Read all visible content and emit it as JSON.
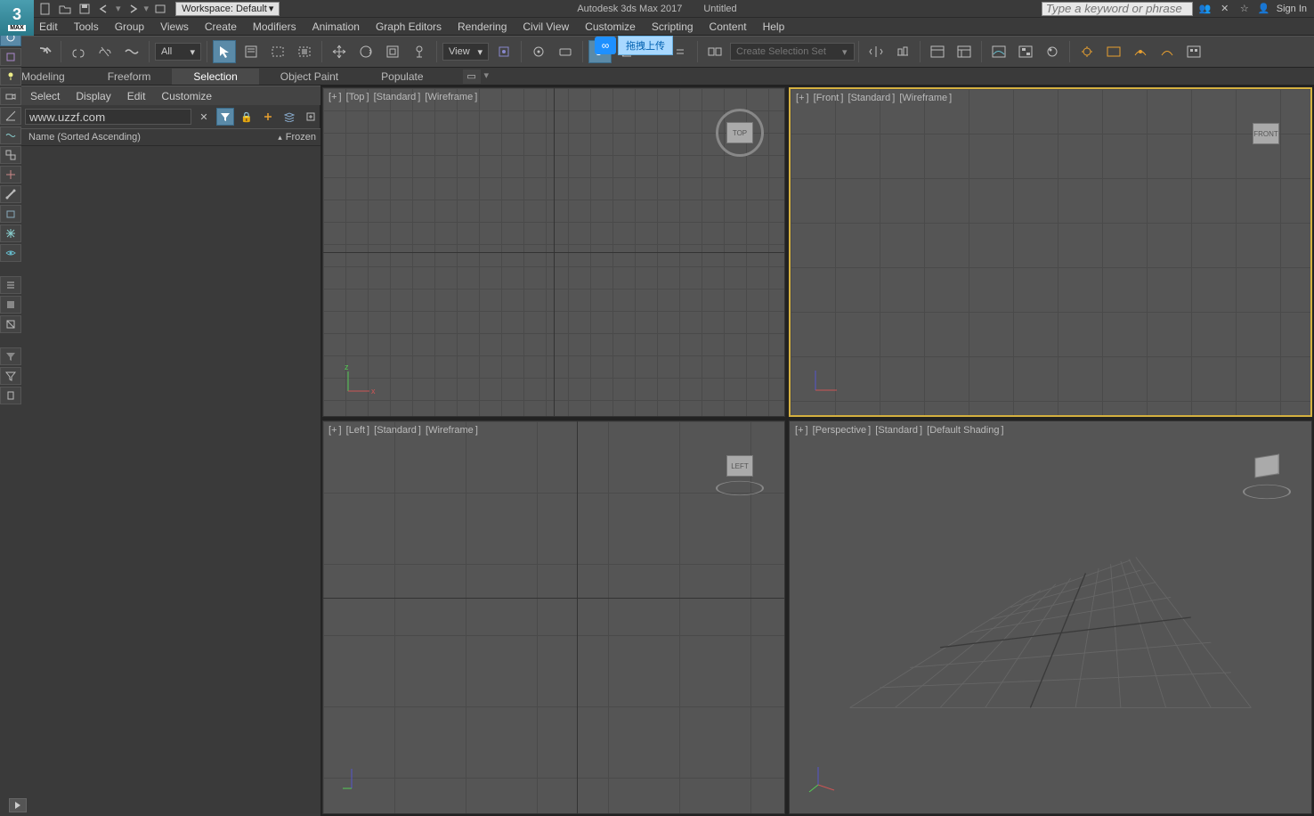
{
  "title": {
    "app": "Autodesk 3ds Max 2017",
    "doc": "Untitled"
  },
  "workspace": {
    "label": "Workspace: Default",
    "suffix": "▾"
  },
  "search": {
    "placeholder": "Type a keyword or phrase"
  },
  "signin": "Sign In",
  "menu": [
    "Edit",
    "Tools",
    "Group",
    "Views",
    "Create",
    "Modifiers",
    "Animation",
    "Graph Editors",
    "Rendering",
    "Civil View",
    "Customize",
    "Scripting",
    "Content",
    "Help"
  ],
  "toolbar": {
    "filter_dd": "All",
    "view_dd": "View",
    "selset_placeholder": "Create Selection Set"
  },
  "floating_tag": "拖拽上传",
  "ribbon": {
    "tabs": [
      "Modeling",
      "Freeform",
      "Selection",
      "Object Paint",
      "Populate"
    ],
    "active": 2
  },
  "scene_explorer": {
    "tabs": [
      "Select",
      "Display",
      "Edit",
      "Customize"
    ],
    "search": "www.uzzf.com",
    "header_name": "Name (Sorted Ascending)",
    "header_frozen": "Frozen",
    "frozen_arrow": "▴",
    "filter_icons": [
      "circle",
      "cube",
      "light",
      "camera",
      "helper",
      "spacewarp",
      "bone",
      "ik",
      "point",
      "container",
      "frozen",
      "hidden",
      "visible",
      "sep",
      "list",
      "list2",
      "list3",
      "sep",
      "funnel-group",
      "funnel",
      "tag"
    ]
  },
  "viewports": {
    "top": {
      "label_parts": [
        "+",
        "Top",
        "Standard",
        "Wireframe"
      ],
      "cube": "TOP"
    },
    "front": {
      "label_parts": [
        "+",
        "Front",
        "Standard",
        "Wireframe"
      ],
      "cube": "FRONT"
    },
    "left": {
      "label_parts": [
        "+",
        "Left",
        "Standard",
        "Wireframe"
      ],
      "cube": "LEFT"
    },
    "persp": {
      "label_parts": [
        "+",
        "Perspective",
        "Standard",
        "Default Shading"
      ],
      "cube": ""
    }
  }
}
